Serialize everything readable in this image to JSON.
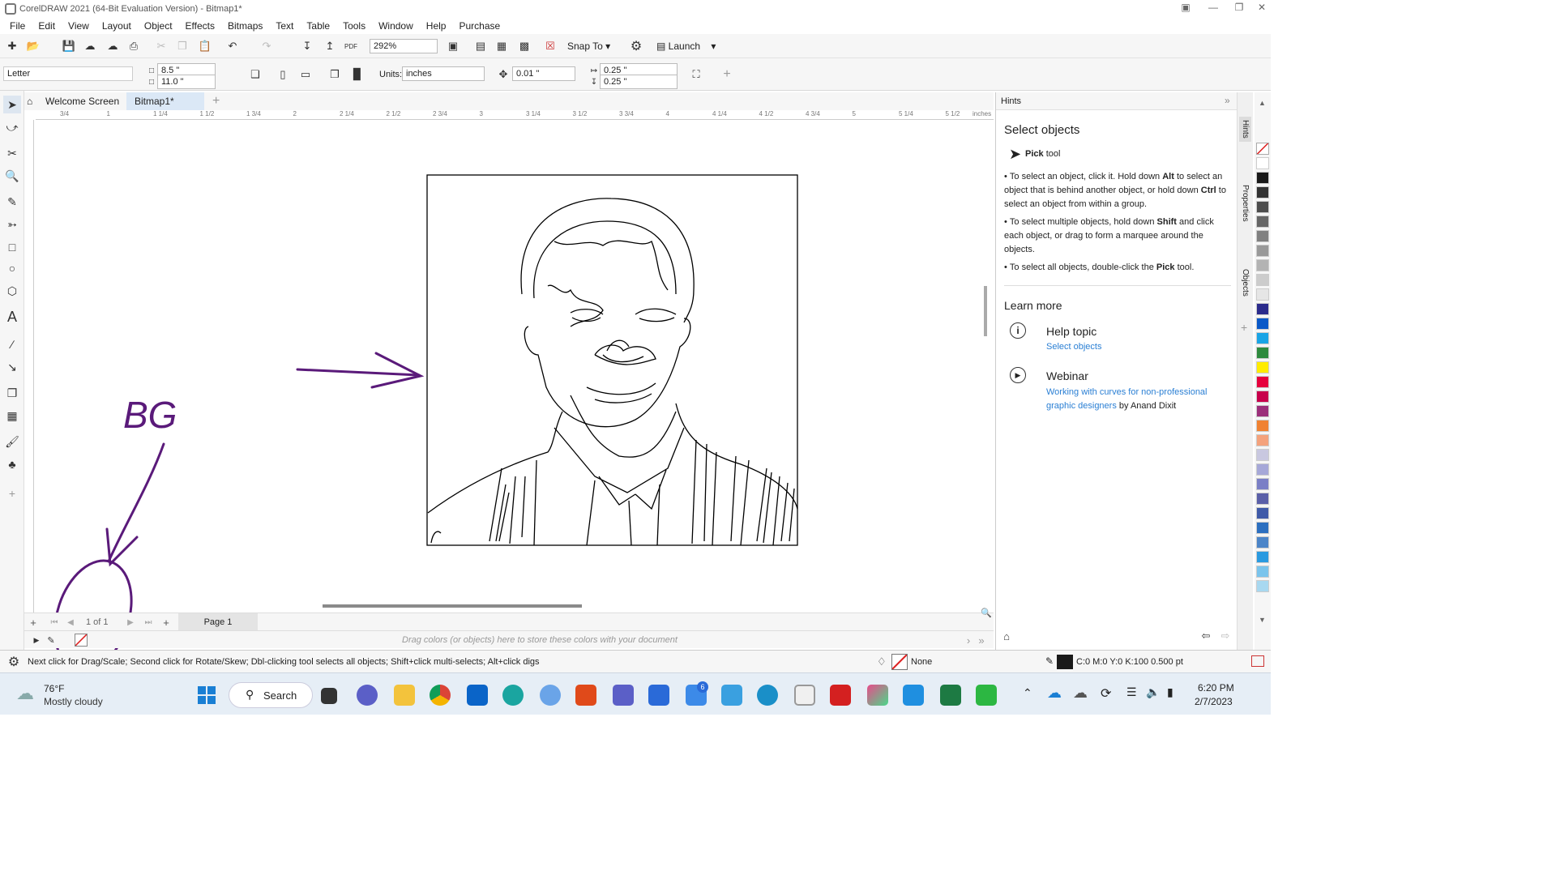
{
  "window": {
    "title": "CorelDRAW 2021 (64-Bit Evaluation Version) - Bitmap1*"
  },
  "menu": [
    "File",
    "Edit",
    "View",
    "Layout",
    "Object",
    "Effects",
    "Bitmaps",
    "Text",
    "Table",
    "Tools",
    "Window",
    "Help",
    "Purchase"
  ],
  "toolbar": {
    "zoom": "292%",
    "snap_to": "Snap To",
    "launch": "Launch",
    "pdf_label": "PDF"
  },
  "propbar": {
    "page_size": "Letter",
    "width": "8.5 \"",
    "height": "11.0 \"",
    "units_label": "Units:",
    "units": "inches",
    "nudge": "0.01 \"",
    "dup_x": "0.25 \"",
    "dup_y": "0.25 \""
  },
  "doc_tabs": {
    "welcome": "Welcome Screen",
    "doc": "Bitmap1*"
  },
  "ruler": {
    "h_labels": [
      "3/4",
      "1",
      "1 1/4",
      "1 1/2",
      "1 3/4",
      "2",
      "2 1/4",
      "2 1/2",
      "2 3/4",
      "3",
      "3 1/4",
      "3 1/2",
      "3 3/4",
      "4",
      "4 1/4",
      "4 1/2",
      "4 3/4",
      "5",
      "5 1/4",
      "5 1/2"
    ],
    "units": "inches"
  },
  "annotation": {
    "text": "BG"
  },
  "pagebar": {
    "page_count": "1 of 1",
    "page_tab": "Page 1"
  },
  "palette_bar": {
    "hint": "Drag colors (or objects) here to store these colors with your document"
  },
  "status": {
    "message": "Next click for Drag/Scale; Second click for Rotate/Skew; Dbl-clicking tool selects all objects; Shift+click multi-selects; Alt+click digs",
    "fill": "None",
    "outline": "C:0 M:0 Y:0 K:100  0.500 pt"
  },
  "docker": {
    "title": "Hints",
    "heading": "Select objects",
    "tool_bold": "Pick",
    "tool_rest": " tool",
    "bullets": [
      {
        "a": "To select an object, click it. Hold down ",
        "b1": "Alt",
        "c": " to select an object that is behind another object, or hold down ",
        "b2": "Ctrl",
        "d": " to select an object from within a group."
      },
      {
        "a": "To select multiple objects, hold down ",
        "b1": "Shift",
        "c": " and click each object, or drag to form a marquee around the objects."
      },
      {
        "a": "To select all objects, double-click the ",
        "b1": "Pick",
        "c": " tool."
      }
    ],
    "learn_more": "Learn more",
    "help_topic": "Help topic",
    "help_link": "Select objects",
    "webinar": "Webinar",
    "webinar_link": "Working with curves for non-professional graphic designers",
    "webinar_by": " by Anand Dixit"
  },
  "docker_tabs": [
    "Hints",
    "Properties",
    "Objects"
  ],
  "palette_colors": [
    "#ffffff",
    "#1a1a1a",
    "#333333",
    "#4d4d4d",
    "#666666",
    "#808080",
    "#999999",
    "#b3b3b3",
    "#cccccc",
    "#e6e6e6",
    "#2b2b8c",
    "#0a59c8",
    "#19a4e6",
    "#2e8a3e",
    "#ffec00",
    "#e6003c",
    "#c8004b",
    "#9b2f7a",
    "#f08232",
    "#f4a27c",
    "#c9c8e0",
    "#a6a8d8",
    "#7a7fc6",
    "#5a5fa8",
    "#3f5aa8",
    "#2c6fc0",
    "#4c85c8",
    "#2a9ae0",
    "#7ac4ec",
    "#a8d8f0"
  ],
  "weather": {
    "temp": "76°F",
    "desc": "Mostly cloudy"
  },
  "taskbar": {
    "search": "Search",
    "time": "6:20 PM",
    "date": "2/7/2023",
    "badge": "6"
  }
}
